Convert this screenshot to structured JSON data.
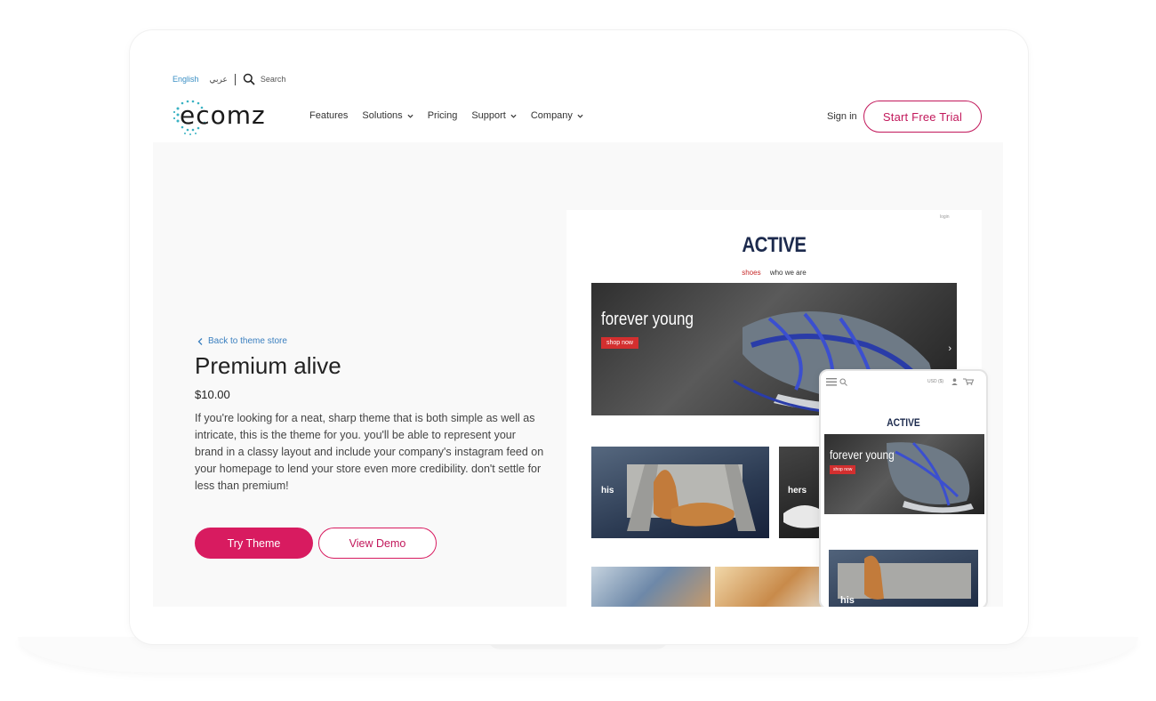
{
  "utility": {
    "lang_en": "English",
    "lang_ar": "عربي",
    "search_label": "Search"
  },
  "brand": {
    "logo_text": "ecomz"
  },
  "nav": {
    "items": [
      {
        "label": "Features",
        "has_dropdown": false
      },
      {
        "label": "Solutions",
        "has_dropdown": true
      },
      {
        "label": "Pricing",
        "has_dropdown": false
      },
      {
        "label": "Support",
        "has_dropdown": true
      },
      {
        "label": "Company",
        "has_dropdown": true
      }
    ],
    "signin": "Sign in",
    "trial_button": "Start Free Trial"
  },
  "theme": {
    "back_link": "Back to theme store",
    "title": "Premium alive",
    "price": "$10.00",
    "description": "If you're looking for a neat, sharp theme that is both simple as well as intricate, this is the theme for you. you'll be able to represent your brand in a classy layout and include your company's instagram feed on your homepage to lend your store even more credibility. don't settle for less than premium!",
    "try_button": "Try Theme",
    "demo_button": "View Demo"
  },
  "preview": {
    "login": "login",
    "brand": "ACTIVE",
    "nav_active": "shoes",
    "nav_other": "who we are",
    "hero_tagline": "forever young",
    "hero_cta": "shop now",
    "tile_his": "his",
    "tile_hers": "hers"
  },
  "phone": {
    "currency": "USD ($)",
    "brand": "ACTIVE",
    "hero_tagline": "forever young",
    "hero_cta": "shop now",
    "tile_label": "his"
  },
  "colors": {
    "accent": "#d81b60",
    "link": "#3a8fc4",
    "preview_brand": "#1c2a4d",
    "preview_cta": "#d32f2f"
  }
}
